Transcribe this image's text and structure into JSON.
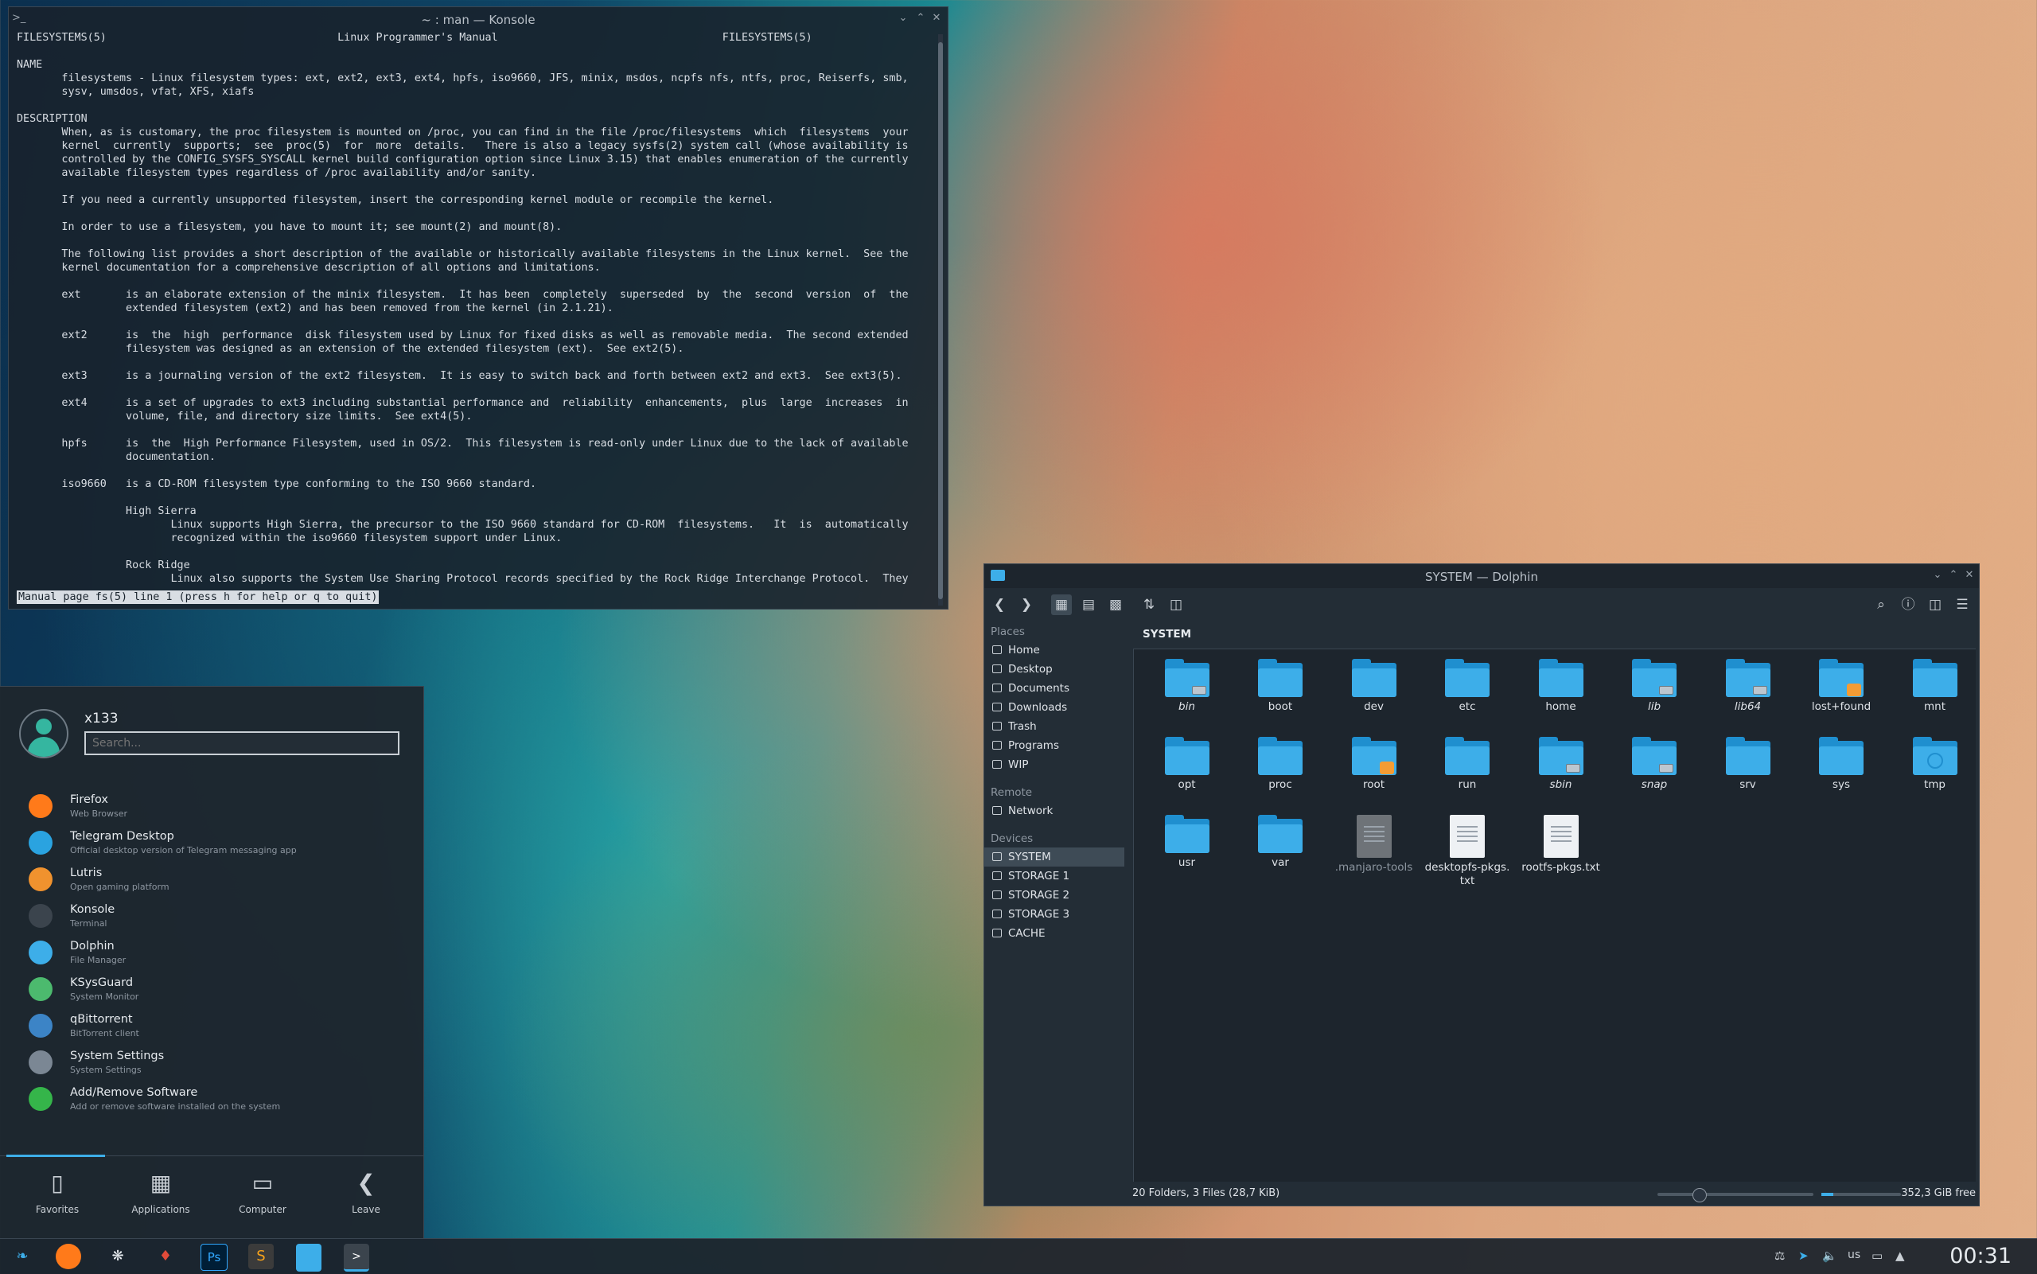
{
  "konsole": {
    "title": "~ : man — Konsole",
    "lines": [
      "FILESYSTEMS(5)                                    Linux Programmer's Manual                                   FILESYSTEMS(5)",
      "",
      "NAME",
      "       filesystems - Linux filesystem types: ext, ext2, ext3, ext4, hpfs, iso9660, JFS, minix, msdos, ncpfs nfs, ntfs, proc, Reiserfs, smb,",
      "       sysv, umsdos, vfat, XFS, xiafs",
      "",
      "DESCRIPTION",
      "       When, as is customary, the proc filesystem is mounted on /proc, you can find in the file /proc/filesystems  which  filesystems  your",
      "       kernel  currently  supports;  see  proc(5)  for  more  details.   There is also a legacy sysfs(2) system call (whose availability is",
      "       controlled by the CONFIG_SYSFS_SYSCALL kernel build configuration option since Linux 3.15) that enables enumeration of the currently",
      "       available filesystem types regardless of /proc availability and/or sanity.",
      "",
      "       If you need a currently unsupported filesystem, insert the corresponding kernel module or recompile the kernel.",
      "",
      "       In order to use a filesystem, you have to mount it; see mount(2) and mount(8).",
      "",
      "       The following list provides a short description of the available or historically available filesystems in the Linux kernel.  See the",
      "       kernel documentation for a comprehensive description of all options and limitations.",
      "",
      "       ext       is an elaborate extension of the minix filesystem.  It has been  completely  superseded  by  the  second  version  of  the",
      "                 extended filesystem (ext2) and has been removed from the kernel (in 2.1.21).",
      "",
      "       ext2      is  the  high  performance  disk filesystem used by Linux for fixed disks as well as removable media.  The second extended",
      "                 filesystem was designed as an extension of the extended filesystem (ext).  See ext2(5).",
      "",
      "       ext3      is a journaling version of the ext2 filesystem.  It is easy to switch back and forth between ext2 and ext3.  See ext3(5).",
      "",
      "       ext4      is a set of upgrades to ext3 including substantial performance and  reliability  enhancements,  plus  large  increases  in",
      "                 volume, file, and directory size limits.  See ext4(5).",
      "",
      "       hpfs      is  the  High Performance Filesystem, used in OS/2.  This filesystem is read-only under Linux due to the lack of available",
      "                 documentation.",
      "",
      "       iso9660   is a CD-ROM filesystem type conforming to the ISO 9660 standard.",
      "",
      "                 High Sierra",
      "                        Linux supports High Sierra, the precursor to the ISO 9660 standard for CD-ROM  filesystems.   It  is  automatically",
      "                        recognized within the iso9660 filesystem support under Linux.",
      "",
      "                 Rock Ridge",
      "                        Linux also supports the System Use Sharing Protocol records specified by the Rock Ridge Interchange Protocol.  They"
    ],
    "status": "Manual page fs(5) line 1 (press h for help or q to quit)"
  },
  "menu": {
    "username": "x133",
    "search_placeholder": "Search...",
    "apps": [
      {
        "name": "Firefox",
        "desc": "Web Browser",
        "color": "#ff7a1a"
      },
      {
        "name": "Telegram Desktop",
        "desc": "Official desktop version of Telegram messaging app",
        "color": "#2aa3e0"
      },
      {
        "name": "Lutris",
        "desc": "Open gaming platform",
        "color": "#f0922e"
      },
      {
        "name": "Konsole",
        "desc": "Terminal",
        "color": "#3b444d"
      },
      {
        "name": "Dolphin",
        "desc": "File Manager",
        "color": "#3daee9"
      },
      {
        "name": "KSysGuard",
        "desc": "System Monitor",
        "color": "#4cba6e"
      },
      {
        "name": "qBittorrent",
        "desc": "BitTorrent client",
        "color": "#3c84c6"
      },
      {
        "name": "System Settings",
        "desc": "System Settings",
        "color": "#7b8794"
      },
      {
        "name": "Add/Remove Software",
        "desc": "Add or remove software installed on the system",
        "color": "#35b54a"
      }
    ],
    "tabs": [
      "Favorites",
      "Applications",
      "Computer",
      "Leave"
    ]
  },
  "dolphin": {
    "title": "SYSTEM — Dolphin",
    "crumb": "SYSTEM",
    "places_header": "Places",
    "places": [
      "Home",
      "Desktop",
      "Documents",
      "Downloads",
      "Trash",
      "Programs",
      "WIP"
    ],
    "remote_header": "Remote",
    "remote": [
      "Network"
    ],
    "devices_header": "Devices",
    "devices": [
      "SYSTEM",
      "STORAGE 1",
      "STORAGE 2",
      "STORAGE 3",
      "CACHE"
    ],
    "items": [
      {
        "label": "bin"
      },
      {
        "label": "boot"
      },
      {
        "label": "dev"
      },
      {
        "label": "etc"
      },
      {
        "label": "home"
      },
      {
        "label": "lib"
      },
      {
        "label": "lib64"
      },
      {
        "label": "lost+found"
      },
      {
        "label": "mnt"
      },
      {
        "label": "opt"
      },
      {
        "label": "proc"
      },
      {
        "label": "root"
      },
      {
        "label": "run"
      },
      {
        "label": "sbin"
      },
      {
        "label": "snap"
      },
      {
        "label": "srv"
      },
      {
        "label": "sys"
      },
      {
        "label": "tmp"
      },
      {
        "label": "usr"
      },
      {
        "label": "var"
      },
      {
        "label": ".manjaro-tools"
      },
      {
        "label": "desktopfs-pkgs.\ntxt"
      },
      {
        "label": "rootfs-pkgs.txt"
      }
    ],
    "status": "20 Folders, 3 Files (28,7 KiB)",
    "free": "352,3 GiB free",
    "free_fraction": 0.15
  },
  "tray": {
    "layout": "us",
    "time": "00:31"
  }
}
